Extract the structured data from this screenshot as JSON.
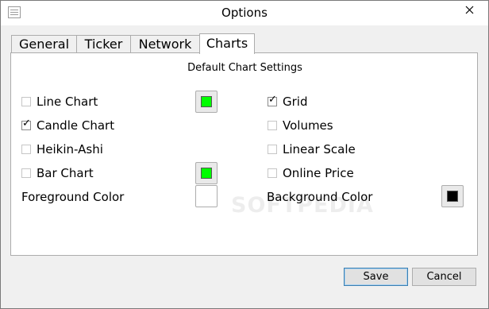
{
  "window": {
    "title": "Options"
  },
  "tabs": [
    {
      "label": "General",
      "active": false
    },
    {
      "label": "Ticker",
      "active": false
    },
    {
      "label": "Network",
      "active": false
    },
    {
      "label": "Charts",
      "active": true
    }
  ],
  "charts": {
    "section_title": "Default Chart Settings",
    "left_options": [
      {
        "label": "Line Chart",
        "checked": false
      },
      {
        "label": "Candle Chart",
        "checked": true
      },
      {
        "label": "Heikin-Ashi",
        "checked": false
      },
      {
        "label": "Bar Chart",
        "checked": false
      }
    ],
    "right_options": [
      {
        "label": "Grid",
        "checked": true
      },
      {
        "label": "Volumes",
        "checked": false
      },
      {
        "label": "Linear Scale",
        "checked": false
      },
      {
        "label": "Online Price",
        "checked": false
      }
    ],
    "foreground_color_label": "Foreground Color",
    "background_color_label": "Background Color",
    "colors": {
      "line_chart": "#00ff00",
      "bar_chart": "#00ff00",
      "foreground": "",
      "background": "#000000"
    }
  },
  "watermark": "SOFTPEDIA",
  "buttons": {
    "save": "Save",
    "cancel": "Cancel"
  }
}
